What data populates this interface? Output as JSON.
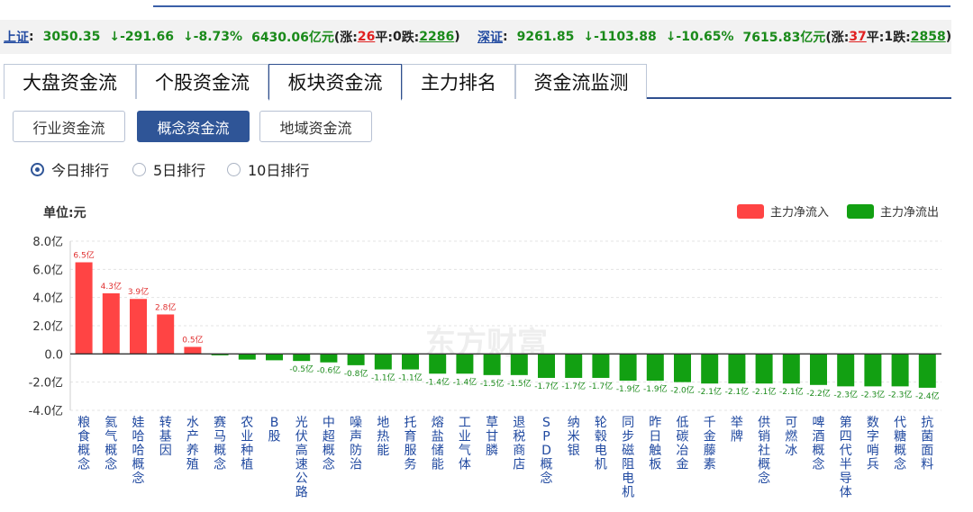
{
  "ticker": {
    "sh": {
      "name": "上证",
      "sep": ":",
      "price": "3050.35",
      "change": "↓-291.66",
      "pct": "↓-8.73%",
      "amount": "6430.06亿元",
      "up_label": "(涨:",
      "up": "26",
      "flat_label": "平:",
      "flat": "0",
      "down_label": "跌:",
      "down": "2286",
      "close": ")"
    },
    "sz": {
      "name": "深证",
      "sep": ":",
      "price": "9261.85",
      "change": "↓-1103.88",
      "pct": "↓-10.65%",
      "amount": "7615.83亿元",
      "up_label": "(涨:",
      "up": "37",
      "flat_label": "平:",
      "flat": "1",
      "down_label": "跌:",
      "down": "2858",
      "close": ")"
    }
  },
  "tabs": [
    "大盘资金流",
    "个股资金流",
    "板块资金流",
    "主力排名",
    "资金流监测"
  ],
  "subtabs": [
    "行业资金流",
    "概念资金流",
    "地域资金流"
  ],
  "radios": [
    "今日排行",
    "5日排行",
    "10日排行"
  ],
  "unit_label": "单位:元",
  "legend": {
    "inflow": "主力净流入",
    "outflow": "主力净流出"
  },
  "watermark": "东方财富",
  "colors": {
    "inflow": "#ff4444",
    "outflow": "#12a012",
    "accent": "#2f5597"
  },
  "chart_data": {
    "type": "bar",
    "yticks": [
      "8.0亿",
      "6.0亿",
      "4.0亿",
      "2.0亿",
      "0.0",
      "-2.0亿",
      "-4.0亿"
    ],
    "ylim": [
      -4,
      8
    ],
    "categories": [
      "粮食概念",
      "氦气概念",
      "娃哈哈概念",
      "转基因",
      "水产养殖",
      "赛马概念",
      "农业种植",
      "B股",
      "光伏高速公路",
      "中超概念",
      "噪声防治",
      "地热能",
      "托育服务",
      "熔盐储能",
      "工业气体",
      "草甘膦",
      "退税商店",
      "SPD概念",
      "纳米银",
      "轮毂电机",
      "同步磁阻电机",
      "昨日触板",
      "低碳冶金",
      "千金藤素",
      "举牌",
      "供销社概念",
      "可燃冰",
      "啤酒概念",
      "第四代半导体",
      "数字哨兵",
      "代糖概念",
      "抗菌面料"
    ],
    "values": [
      6.5,
      4.3,
      3.9,
      2.8,
      0.5,
      -0.1,
      -0.4,
      -0.45,
      -0.5,
      -0.6,
      -0.8,
      -1.1,
      -1.1,
      -1.4,
      -1.4,
      -1.5,
      -1.5,
      -1.7,
      -1.7,
      -1.7,
      -1.9,
      -1.9,
      -2.0,
      -2.1,
      -2.1,
      -2.1,
      -2.1,
      -2.2,
      -2.3,
      -2.3,
      -2.3,
      -2.4
    ],
    "data_labels": [
      "6.5亿",
      "4.3亿",
      "3.9亿",
      "2.8亿",
      "0.5亿",
      "",
      "",
      "",
      "-0.5亿",
      "-0.6亿",
      "-0.8亿",
      "-1.1亿",
      "-1.1亿",
      "-1.4亿",
      "-1.4亿",
      "-1.5亿",
      "-1.5亿",
      "-1.7亿",
      "-1.7亿",
      "-1.7亿",
      "-1.9亿",
      "-1.9亿",
      "-2.0亿",
      "-2.1亿",
      "-2.1亿",
      "-2.1亿",
      "-2.1亿",
      "-2.2亿",
      "-2.3亿",
      "-2.3亿",
      "-2.3亿",
      "-2.4亿"
    ],
    "grid": true,
    "legend_position": "top-right"
  }
}
